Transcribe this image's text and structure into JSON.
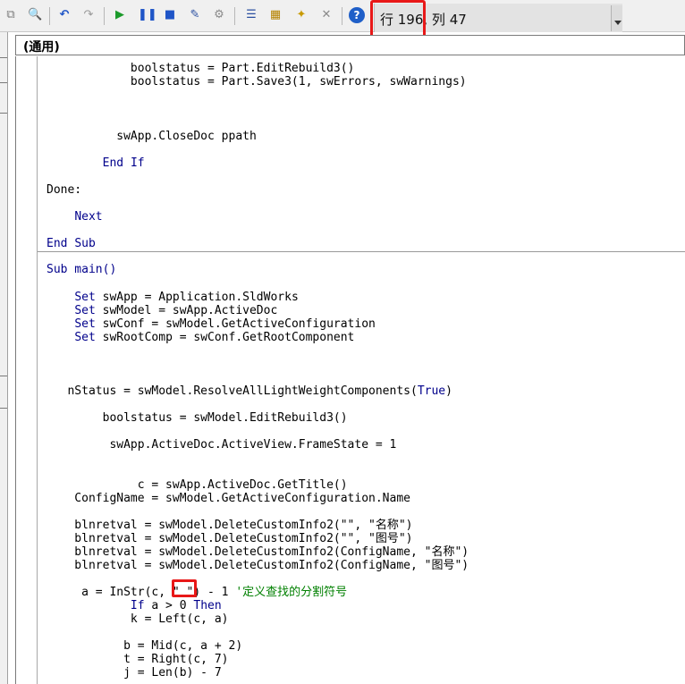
{
  "toolbar": {
    "icons": [
      "copy-icon",
      "find-icon",
      "undo-icon",
      "redo-icon",
      "run-icon",
      "pause-icon",
      "stop-icon",
      "design-mode-icon",
      "userform-icon",
      "project-explorer-icon",
      "properties-icon",
      "object-browser-icon",
      "toolbox-icon",
      "help-icon"
    ],
    "status_label": "行 196, 列 47"
  },
  "object_combo": {
    "value": "(通用)"
  },
  "code_lines": [
    "            boolstatus = Part.EditRebuild3()",
    "            boolstatus = Part.Save3(1, swErrors, swWarnings)",
    "",
    "",
    "",
    "          swApp.CloseDoc ppath",
    "",
    "        End If",
    "",
    "Done:",
    "",
    "    Next",
    "",
    "End Sub",
    "",
    "Sub main()",
    "",
    "    Set swApp = Application.SldWorks",
    "    Set swModel = swApp.ActiveDoc",
    "    Set swConf = swModel.GetActiveConfiguration",
    "    Set swRootComp = swConf.GetRootComponent",
    "",
    "",
    "",
    "   nStatus = swModel.ResolveAllLightWeightComponents(True)",
    "",
    "        boolstatus = swModel.EditRebuild3()",
    "",
    "         swApp.ActiveDoc.ActiveView.FrameState = 1",
    "",
    "",
    "             c = swApp.ActiveDoc.GetTitle()",
    "    ConfigName = swModel.GetActiveConfiguration.Name",
    "",
    "    blnretval = swModel.DeleteCustomInfo2(\"\", \"名称\")",
    "    blnretval = swModel.DeleteCustomInfo2(\"\", \"图号\")",
    "    blnretval = swModel.DeleteCustomInfo2(ConfigName, \"名称\")",
    "    blnretval = swModel.DeleteCustomInfo2(ConfigName, \"图号\")",
    "",
    "     a = InStr(c, \" \") - 1 '定义查找的分割符号",
    "            If a > 0 Then",
    "            k = Left(c, a)",
    "",
    "           b = Mid(c, a + 2)",
    "           t = Right(c, 7)",
    "           j = Len(b) - 7"
  ],
  "colors": {
    "keyword": "#00008b",
    "comment": "#008000",
    "highlight": "#e81818"
  }
}
